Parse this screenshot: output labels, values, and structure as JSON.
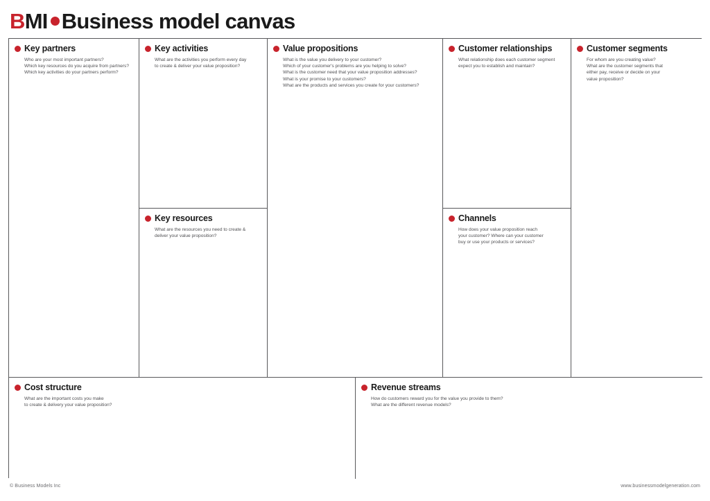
{
  "header": {
    "logo_b": "B",
    "logo_mi": "MI",
    "dot_icon": "red-dot-icon",
    "title": "Business model canvas"
  },
  "canvas": {
    "blocks": [
      {
        "id": "key-partners",
        "title": "Key partners",
        "questions": [
          "Who are your most important partners?",
          "Which key resources do you acquire from partners?",
          "Which key activities do your partners perform?"
        ]
      },
      {
        "id": "key-activities",
        "title": "Key activities",
        "questions": [
          "What are the activities you perform every day",
          "to create & deliver your value proposition?"
        ]
      },
      {
        "id": "key-resources",
        "title": "Key resources",
        "questions": [
          "What are the resources you need to create &",
          "deliver your value proposition?"
        ]
      },
      {
        "id": "value-propositions",
        "title": "Value propositions",
        "questions": [
          "What is the value you delivery to your customer?",
          "Which of your customer's problems are you helping to solve?",
          "What is the customer need that your value proposition addresses?",
          "What is your promise to your customers?",
          "What are the products and services you create for your customers?"
        ]
      },
      {
        "id": "customer-relationships",
        "title": "Customer relationships",
        "questions": [
          "What relationship does each customer segment",
          "expect you to establish and maintain?"
        ]
      },
      {
        "id": "channels",
        "title": "Channels",
        "questions": [
          "How does your value proposition reach",
          "your customer? Where can your customer",
          "buy or use your products or services?"
        ]
      },
      {
        "id": "customer-segments",
        "title": "Customer segments",
        "questions": [
          "For whom are you creating value?",
          "What are the customer segments that",
          "either pay, receive or decide on your",
          "value proposition?"
        ]
      },
      {
        "id": "cost-structure",
        "title": "Cost structure",
        "questions": [
          "What are the important costs you make",
          "to create & delivery your value proposition?"
        ]
      },
      {
        "id": "revenue-streams",
        "title": "Revenue streams",
        "questions": [
          "How do customers reward you for the value you provide to them?",
          "What are the different revenue models?"
        ]
      }
    ]
  },
  "footer": {
    "copyright": "© Business Models Inc",
    "website": "www.businessmodelgeneration.com"
  },
  "colors": {
    "accent_red": "#C8232C",
    "border_gray": "#58585a",
    "body_text": "#4f4f52"
  }
}
